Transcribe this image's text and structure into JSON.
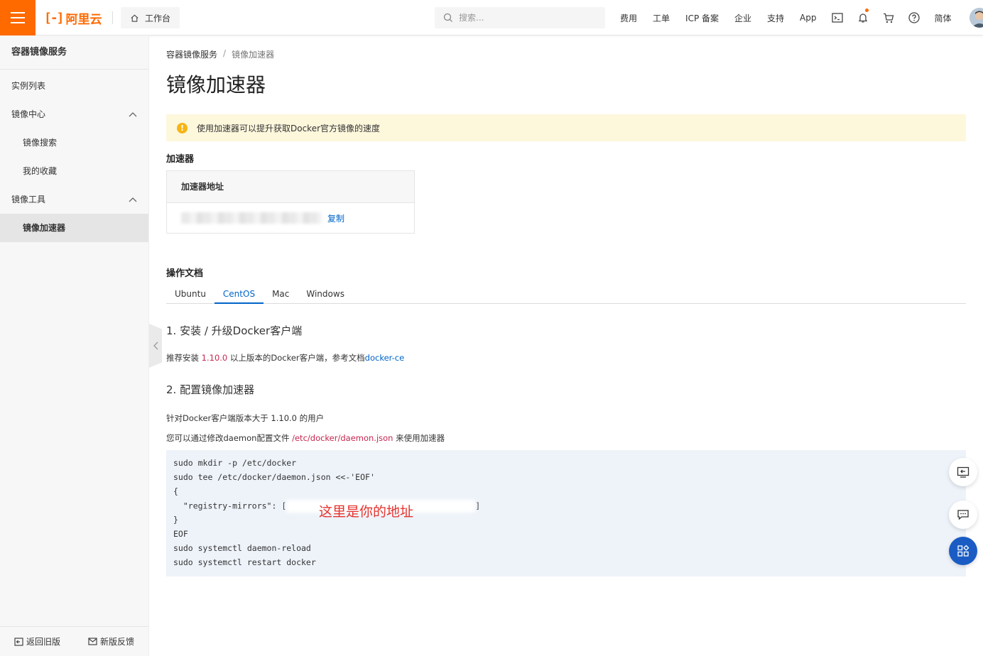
{
  "header": {
    "logo_text": "阿里云",
    "logo_mark": "[-]",
    "workbench_label": "工作台",
    "search_placeholder": "搜索...",
    "nav": [
      "费用",
      "工单",
      "ICP 备案",
      "企业",
      "支持",
      "App"
    ],
    "language": "简体"
  },
  "sidebar": {
    "title": "容器镜像服务",
    "items": [
      {
        "label": "实例列表"
      },
      {
        "label": "镜像中心"
      },
      {
        "label": "镜像搜索"
      },
      {
        "label": "我的收藏"
      },
      {
        "label": "镜像工具"
      },
      {
        "label": "镜像加速器"
      }
    ],
    "footer_back": "返回旧版",
    "footer_feedback": "新版反馈"
  },
  "breadcrumb": {
    "parent": "容器镜像服务",
    "separator": "/",
    "current": "镜像加速器"
  },
  "page_title": "镜像加速器",
  "alert_text": "使用加速器可以提升获取Docker官方镜像的速度",
  "accelerator": {
    "section_title": "加速器",
    "column_header": "加速器地址",
    "copy_label": "复制"
  },
  "docs": {
    "section_title": "操作文档",
    "tabs": [
      "Ubuntu",
      "CentOS",
      "Mac",
      "Windows"
    ],
    "active_tab": "CentOS",
    "step1_title": "1. 安装 / 升级Docker客户端",
    "step1_prefix": "推荐安装 ",
    "step1_version": "1.10.0",
    "step1_middle": " 以上版本的Docker客户端，参考文档",
    "step1_link": "docker-ce",
    "step2_title": "2. 配置镜像加速器",
    "step2_line1": "针对Docker客户端版本大于 1.10.0 的用户",
    "step2_line2_prefix": "您可以通过修改daemon配置文件 ",
    "step2_path": "/etc/docker/daemon.json",
    "step2_line2_suffix": " 来使用加速器",
    "code_lines": [
      "sudo mkdir -p /etc/docker",
      "sudo tee /etc/docker/daemon.json <<-'EOF'",
      "{",
      "  \"registry-mirrors\": [",
      "}",
      "EOF",
      "sudo systemctl daemon-reload",
      "sudo systemctl restart docker"
    ],
    "code_line4_end": "]",
    "annotation": "这里是你的地址"
  },
  "colors": {
    "brand": "#ff6a00",
    "link": "#0064c8",
    "alert_bg": "#fdf7dc",
    "code_bg": "#eef3fa",
    "annotation": "#e5322d"
  }
}
